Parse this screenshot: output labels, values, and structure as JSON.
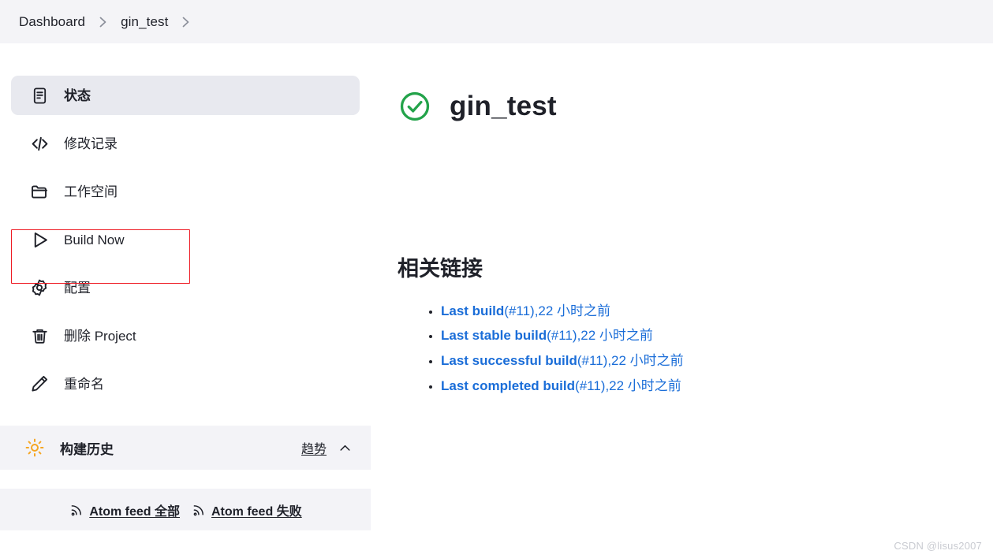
{
  "breadcrumb": {
    "items": [
      {
        "label": "Dashboard"
      },
      {
        "label": "gin_test"
      }
    ],
    "separator_icon": "chevron-right-icon"
  },
  "sidebar": {
    "tasks": [
      {
        "label": "状态",
        "icon": "document-icon",
        "active": true
      },
      {
        "label": "修改记录",
        "icon": "code-icon",
        "active": false
      },
      {
        "label": "工作空间",
        "icon": "folder-icon",
        "active": false
      },
      {
        "label": "Build Now",
        "icon": "play-icon",
        "active": false
      },
      {
        "label": "配置",
        "icon": "gear-icon",
        "active": false
      },
      {
        "label": "删除 Project",
        "icon": "trash-icon",
        "active": false
      },
      {
        "label": "重命名",
        "icon": "pencil-icon",
        "active": false
      }
    ],
    "build_history": {
      "title": "构建历史",
      "icon": "sun-icon",
      "trend_label": "趋势",
      "collapse_icon": "chevron-up-icon"
    },
    "atom_feeds": [
      {
        "label": "Atom feed 全部",
        "icon": "rss-icon"
      },
      {
        "label": "Atom feed 失败",
        "icon": "rss-icon"
      }
    ]
  },
  "main": {
    "job": {
      "title": "gin_test",
      "status_icon": "check-circle-icon",
      "status_color": "#23a34a"
    },
    "related_links": {
      "heading": "相关链接",
      "items": [
        {
          "strong": "Last build",
          "rest": "(#11),22 小时之前"
        },
        {
          "strong": "Last stable build",
          "rest": "(#11),22 小时之前"
        },
        {
          "strong": "Last successful build",
          "rest": "(#11),22 小时之前"
        },
        {
          "strong": "Last completed build",
          "rest": "(#11),22 小时之前"
        }
      ],
      "link_color": "#1a6dd8"
    }
  },
  "annotation": {
    "target": "Build Now",
    "color": "#ee1b24"
  },
  "watermark": "CSDN @lisus2007"
}
